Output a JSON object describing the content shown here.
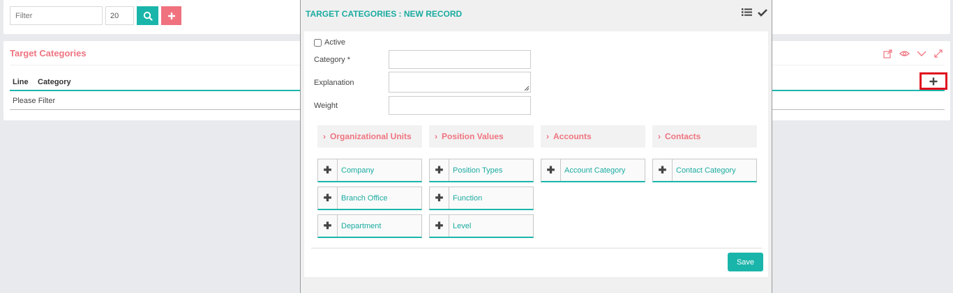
{
  "toolbar": {
    "filter_placeholder": "Filter",
    "page_size": "20"
  },
  "list": {
    "title": "Target Categories",
    "columns": [
      "Line",
      "Category"
    ],
    "empty_text": "Please Filter"
  },
  "modal": {
    "title": "TARGET CATEGORIES : NEW RECORD",
    "active_label": "Active",
    "fields": {
      "category_label": "Category *",
      "explanation_label": "Explanation",
      "weight_label": "Weight"
    },
    "sections": [
      {
        "label": "Organizational Units",
        "items": [
          "Company",
          "Branch Office",
          "Department"
        ]
      },
      {
        "label": "Position Values",
        "items": [
          "Position Types",
          "Function",
          "Level"
        ]
      },
      {
        "label": "Accounts",
        "items": [
          "Account Category"
        ]
      },
      {
        "label": "Contacts",
        "items": [
          "Contact Category"
        ]
      }
    ],
    "save_label": "Save"
  },
  "colors": {
    "accent": "#1ab5aa",
    "brand_red": "#ef7480",
    "highlight": "#e0101e"
  }
}
